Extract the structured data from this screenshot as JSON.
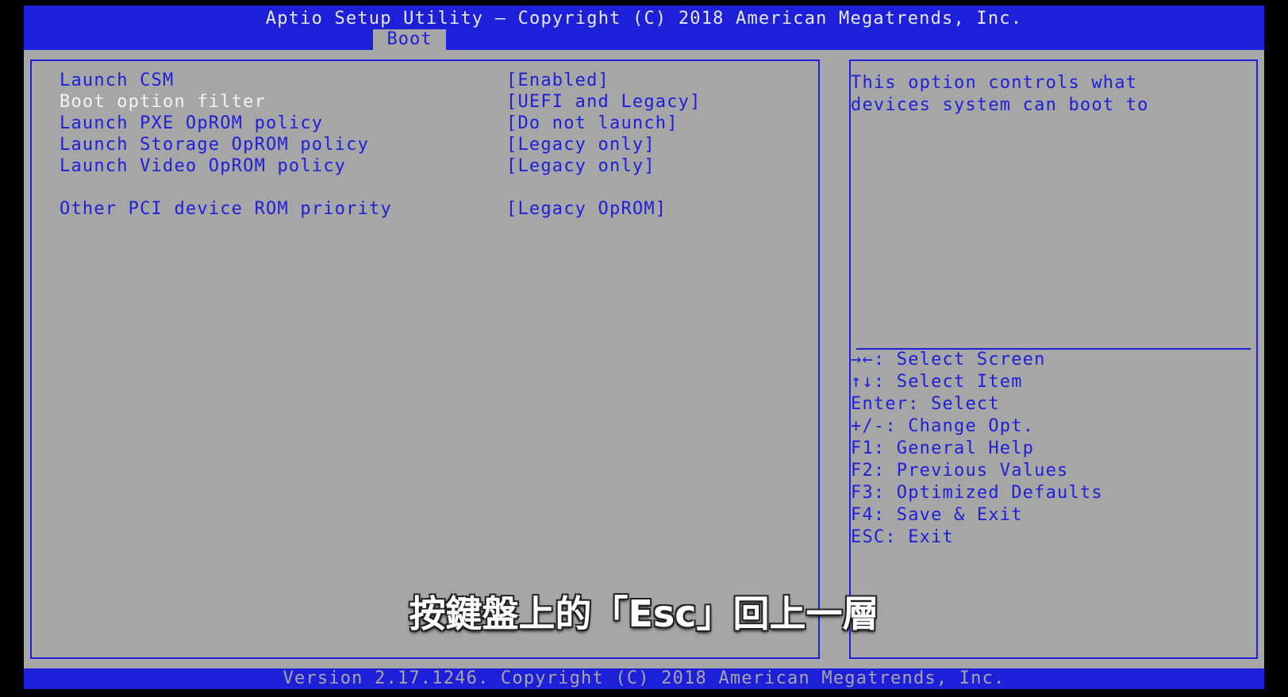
{
  "header": {
    "title": "Aptio Setup Utility – Copyright (C) 2018 American Megatrends, Inc.",
    "active_tab": "Boot"
  },
  "settings": [
    {
      "label": "Launch CSM",
      "value": "[Enabled]"
    },
    {
      "label": "Boot option filter",
      "value": "[UEFI and Legacy]"
    },
    {
      "label": "Launch PXE OpROM policy",
      "value": "[Do not launch]"
    },
    {
      "label": "Launch Storage OpROM policy",
      "value": "[Legacy only]"
    },
    {
      "label": "Launch Video OpROM policy",
      "value": "[Legacy only]"
    },
    {
      "label": "Other PCI device ROM priority",
      "value": "[Legacy OpROM]"
    }
  ],
  "help": {
    "line1": "This option controls what",
    "line2": "devices system can boot to"
  },
  "keys": [
    "→←: Select Screen",
    "↑↓: Select Item",
    "Enter: Select",
    "+/-: Change Opt.",
    "F1: General Help",
    "F2: Previous Values",
    "F3: Optimized Defaults",
    "F4: Save & Exit",
    "ESC: Exit"
  ],
  "subtitle": "按鍵盤上的「Esc」回上一層",
  "footer": "Version 2.17.1246. Copyright (C) 2018 American Megatrends, Inc.",
  "colors": {
    "bios_blue": "#1d1fd9",
    "panel_gray": "#a6a6a6",
    "selected_text": "#f4f4f4"
  }
}
